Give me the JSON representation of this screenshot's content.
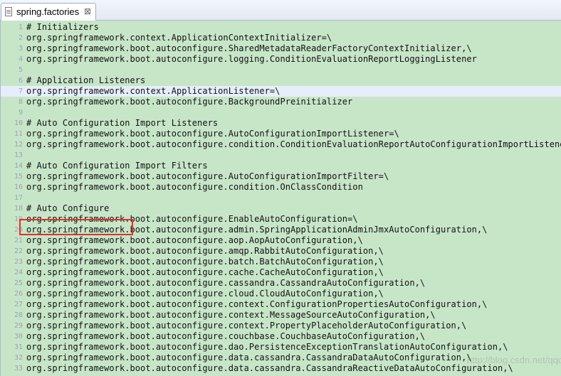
{
  "tab": {
    "title": "spring.factories",
    "close_glyph": "⊠"
  },
  "watermark": "http://blog.csdn.net/qqchaozai",
  "lines": [
    {
      "num": "1",
      "text": "# Initializers"
    },
    {
      "num": "2",
      "text": "org.springframework.context.ApplicationContextInitializer=\\"
    },
    {
      "num": "3",
      "text": "org.springframework.boot.autoconfigure.SharedMetadataReaderFactoryContextInitializer,\\"
    },
    {
      "num": "4",
      "text": "org.springframework.boot.autoconfigure.logging.ConditionEvaluationReportLoggingListener"
    },
    {
      "num": "5",
      "text": ""
    },
    {
      "num": "6",
      "text": "# Application Listeners"
    },
    {
      "num": "7",
      "text": "org.springframework.context.ApplicationListener=\\",
      "current": true
    },
    {
      "num": "8",
      "text": "org.springframework.boot.autoconfigure.BackgroundPreinitializer"
    },
    {
      "num": "9",
      "text": ""
    },
    {
      "num": "10",
      "text": "# Auto Configuration Import Listeners"
    },
    {
      "num": "11",
      "text": "org.springframework.boot.autoconfigure.AutoConfigurationImportListener=\\"
    },
    {
      "num": "12",
      "text": "org.springframework.boot.autoconfigure.condition.ConditionEvaluationReportAutoConfigurationImportListener"
    },
    {
      "num": "13",
      "text": ""
    },
    {
      "num": "14",
      "text": "# Auto Configuration Import Filters"
    },
    {
      "num": "15",
      "text": "org.springframework.boot.autoconfigure.AutoConfigurationImportFilter=\\"
    },
    {
      "num": "16",
      "text": "org.springframework.boot.autoconfigure.condition.OnClassCondition"
    },
    {
      "num": "17",
      "text": ""
    },
    {
      "num": "18",
      "text": "# Auto Configure"
    },
    {
      "num": "19",
      "text": "org.springframework.boot.autoconfigure.EnableAutoConfiguration=\\"
    },
    {
      "num": "20",
      "text": "org.springframework.boot.autoconfigure.admin.SpringApplicationAdminJmxAutoConfiguration,\\"
    },
    {
      "num": "21",
      "text": "org.springframework.boot.autoconfigure.aop.AopAutoConfiguration,\\"
    },
    {
      "num": "22",
      "text": "org.springframework.boot.autoconfigure.amqp.RabbitAutoConfiguration,\\"
    },
    {
      "num": "23",
      "text": "org.springframework.boot.autoconfigure.batch.BatchAutoConfiguration,\\"
    },
    {
      "num": "24",
      "text": "org.springframework.boot.autoconfigure.cache.CacheAutoConfiguration,\\"
    },
    {
      "num": "25",
      "text": "org.springframework.boot.autoconfigure.cassandra.CassandraAutoConfiguration,\\"
    },
    {
      "num": "26",
      "text": "org.springframework.boot.autoconfigure.cloud.CloudAutoConfiguration,\\"
    },
    {
      "num": "27",
      "text": "org.springframework.boot.autoconfigure.context.ConfigurationPropertiesAutoConfiguration,\\"
    },
    {
      "num": "28",
      "text": "org.springframework.boot.autoconfigure.context.MessageSourceAutoConfiguration,\\"
    },
    {
      "num": "29",
      "text": "org.springframework.boot.autoconfigure.context.PropertyPlaceholderAutoConfiguration,\\"
    },
    {
      "num": "30",
      "text": "org.springframework.boot.autoconfigure.couchbase.CouchbaseAutoConfiguration,\\"
    },
    {
      "num": "31",
      "text": "org.springframework.boot.autoconfigure.dao.PersistenceExceptionTranslationAutoConfiguration,\\"
    },
    {
      "num": "32",
      "text": "org.springframework.boot.autoconfigure.data.cassandra.CassandraDataAutoConfiguration,\\"
    },
    {
      "num": "33",
      "text": "org.springframework.boot.autoconfigure.data.cassandra.CassandraReactiveDataAutoConfiguration,\\"
    }
  ]
}
